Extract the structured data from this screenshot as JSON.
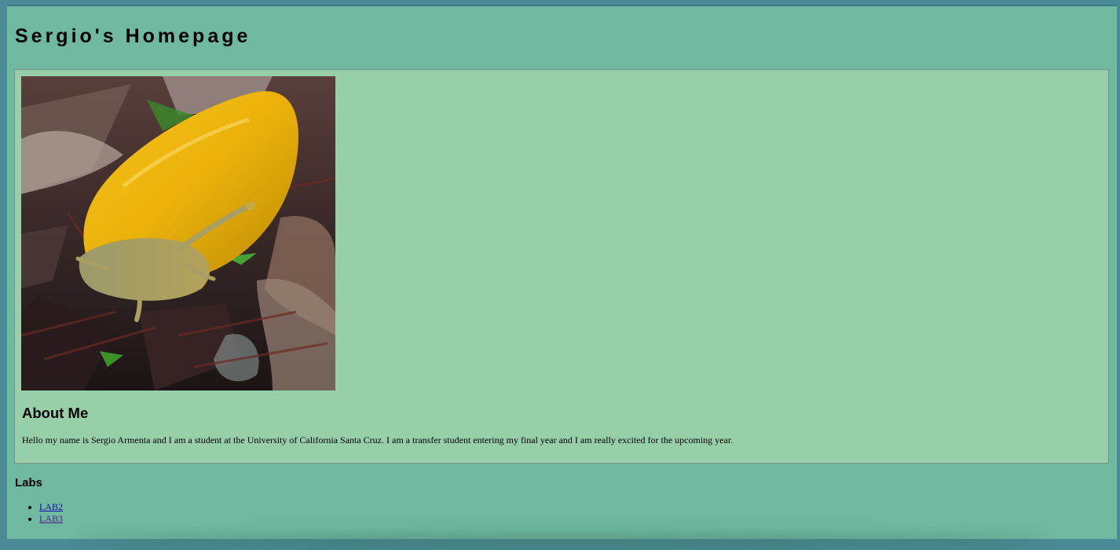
{
  "header": {
    "title": "Sergio's Homepage"
  },
  "card": {
    "photo_icon": "banana-slug-photo",
    "about_heading": "About Me",
    "about_text": "Hello my name is Sergio Armenta and I am a student at the University of California Santa Cruz. I am a transfer student entering my final year and I am really excited for the upcoming year."
  },
  "labs": {
    "heading": "Labs",
    "links": [
      {
        "label": "LAB2",
        "color": "#1a0dab"
      },
      {
        "label": "LAB3",
        "color": "#551a8b"
      }
    ]
  },
  "colors": {
    "page_background": "#6fb9a0",
    "card_background": "#97cfa8",
    "outer_frame": "#4a8a94"
  }
}
